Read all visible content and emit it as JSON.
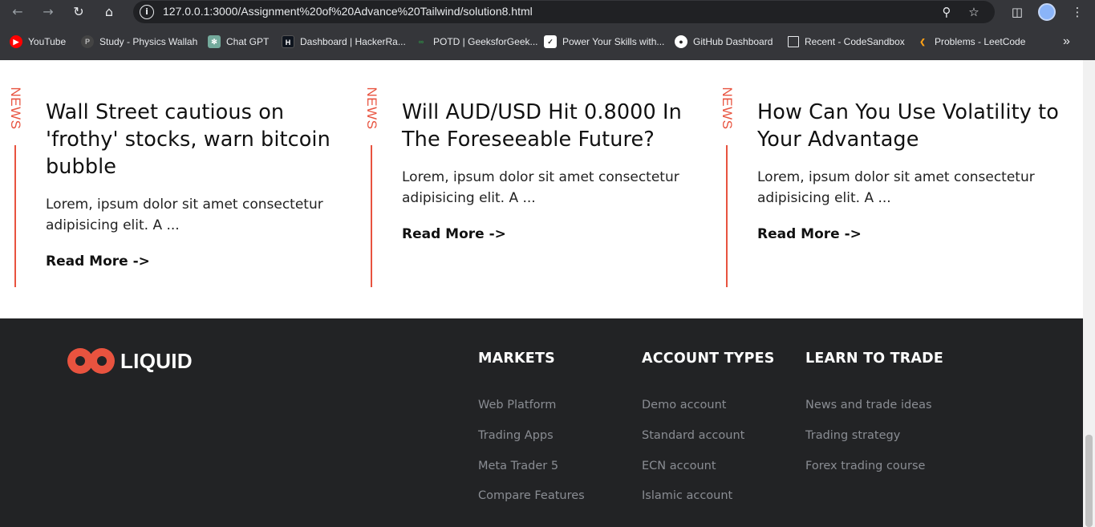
{
  "browser": {
    "url": "127.0.0.1:3000/Assignment%20of%20Advance%20Tailwind/solution8.html",
    "bookmarks": [
      {
        "label": "YouTube",
        "icon": "youtube-icon"
      },
      {
        "label": "Study - Physics Wallah",
        "icon": "physics-wallah-icon"
      },
      {
        "label": "Chat GPT",
        "icon": "chatgpt-icon"
      },
      {
        "label": "Dashboard | HackerRa...",
        "icon": "hackerrank-icon"
      },
      {
        "label": "POTD | GeeksforGeek...",
        "icon": "geeksforgeeks-icon"
      },
      {
        "label": "Power Your Skills with...",
        "icon": "skills-icon"
      },
      {
        "label": "GitHub Dashboard",
        "icon": "github-icon"
      },
      {
        "label": "Recent - CodeSandbox",
        "icon": "codesandbox-icon"
      },
      {
        "label": "Problems - LeetCode",
        "icon": "leetcode-icon"
      }
    ]
  },
  "news": {
    "accent_color": "#e8533f",
    "cards": [
      {
        "tag": "NEWS",
        "title": "Wall Street cautious on 'frothy' stocks, warn bitcoin bubble",
        "text": "Lorem, ipsum dolor sit amet consectetur adipisicing elit. A ...",
        "link": "Read More ->"
      },
      {
        "tag": "NEWS",
        "title": "Will AUD/USD Hit 0.8000 In The Foreseeable Future?",
        "text": "Lorem, ipsum dolor sit amet consectetur adipisicing elit. A ...",
        "link": "Read More ->"
      },
      {
        "tag": "NEWS",
        "title": "How Can You Use Volatility to Your Advantage",
        "text": "Lorem, ipsum dolor sit amet consectetur adipisicing elit. A ...",
        "link": "Read More ->"
      }
    ]
  },
  "footer": {
    "background": "#222325",
    "logo_text": "LIQUID",
    "columns": [
      {
        "heading": "MARKETS",
        "links": [
          "Web Platform",
          "Trading Apps",
          "Meta Trader 5",
          "Compare Features"
        ]
      },
      {
        "heading": "ACCOUNT TYPES",
        "links": [
          "Demo account",
          "Standard account",
          "ECN account",
          "Islamic account"
        ]
      },
      {
        "heading": "LEARN TO TRADE",
        "links": [
          "News and trade ideas",
          "Trading strategy",
          "Forex trading course"
        ]
      }
    ]
  }
}
